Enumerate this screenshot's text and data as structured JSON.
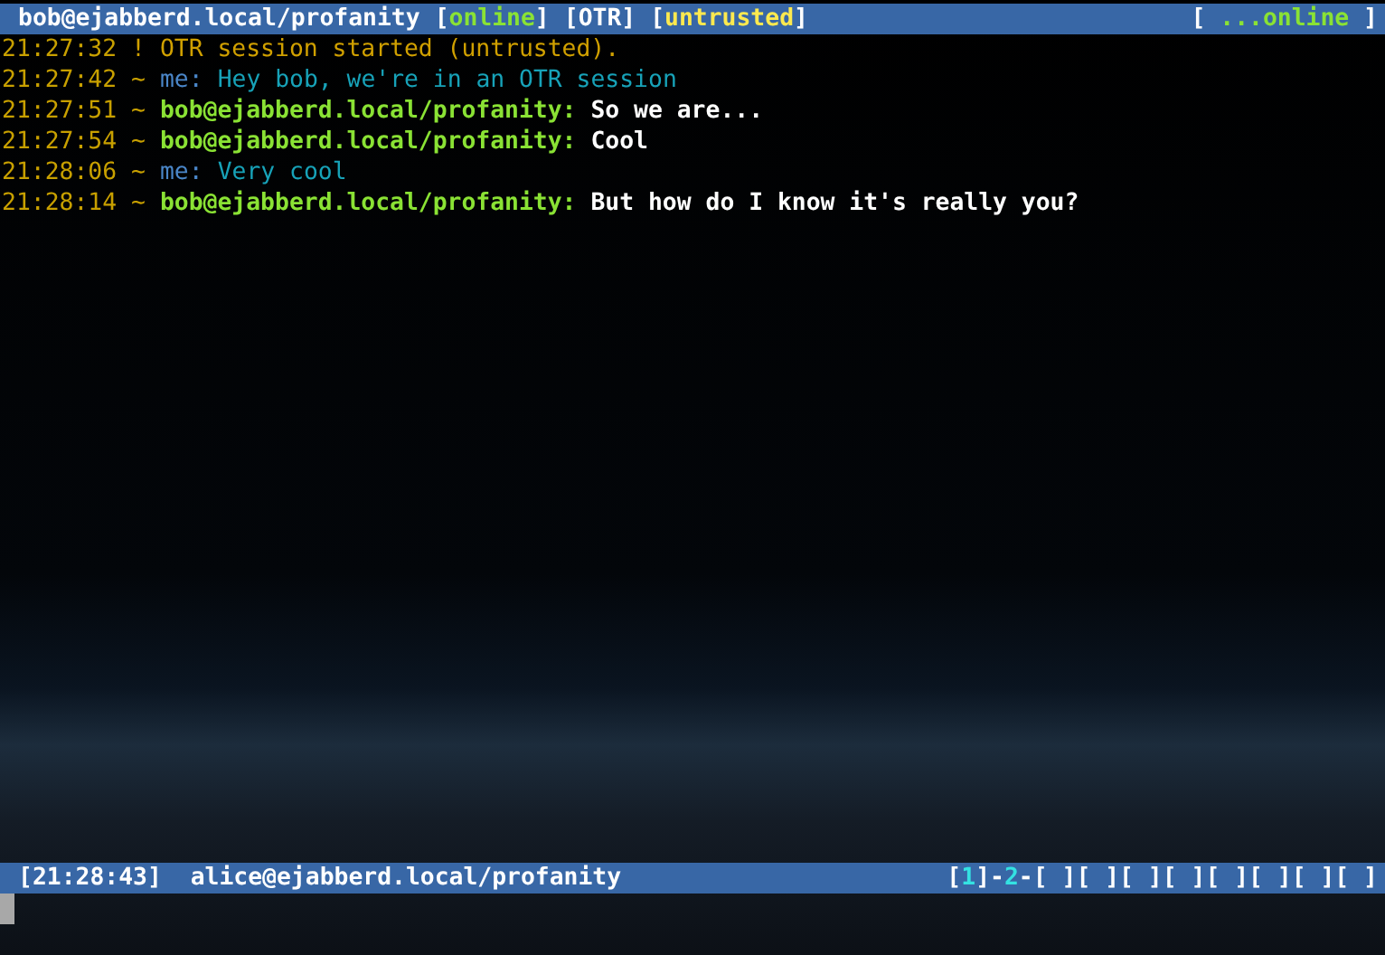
{
  "title_bar": {
    "contact": "bob@ejabberd.local/profanity",
    "tags": [
      {
        "open": "[",
        "text": "online",
        "close": "]",
        "kind": "presence"
      },
      {
        "open": "[",
        "text": "OTR",
        "close": "]",
        "kind": "plain"
      },
      {
        "open": "[",
        "text": "untrusted",
        "close": "]",
        "kind": "warning"
      }
    ],
    "status": {
      "open": "[ ",
      "text": "...online",
      "close": " ]",
      "kind": "presence"
    }
  },
  "messages": [
    {
      "time": "21:27:32",
      "marker": "!",
      "text": "OTR session started (untrusted).",
      "kind": "system"
    },
    {
      "time": "21:27:42",
      "marker": "~",
      "sender": "me:",
      "text": "Hey bob, we're in an OTR session",
      "kind": "outgoing"
    },
    {
      "time": "21:27:51",
      "marker": "~",
      "sender": "bob@ejabberd.local/profanity:",
      "text": "So we are...",
      "kind": "incoming"
    },
    {
      "time": "21:27:54",
      "marker": "~",
      "sender": "bob@ejabberd.local/profanity:",
      "text": "Cool",
      "kind": "incoming"
    },
    {
      "time": "21:28:06",
      "marker": "~",
      "sender": "me:",
      "text": "Very cool",
      "kind": "outgoing"
    },
    {
      "time": "21:28:14",
      "marker": "~",
      "sender": "bob@ejabberd.local/profanity:",
      "text": "But how do I know it's really you?",
      "kind": "incoming"
    }
  ],
  "status_bar": {
    "time": "[21:28:43]",
    "account": "alice@ejabberd.local/profanity",
    "windows": [
      {
        "open": "[",
        "number": "1",
        "close": "]"
      },
      {
        "open": "-",
        "number": "2",
        "close": "-"
      },
      {
        "text": "[ ]"
      },
      {
        "text": "[ ]"
      },
      {
        "text": "[ ]"
      },
      {
        "text": "[ ]"
      },
      {
        "text": "[ ]"
      },
      {
        "text": "[ ]"
      },
      {
        "text": "[ ]"
      },
      {
        "text": "[ ]"
      }
    ]
  }
}
